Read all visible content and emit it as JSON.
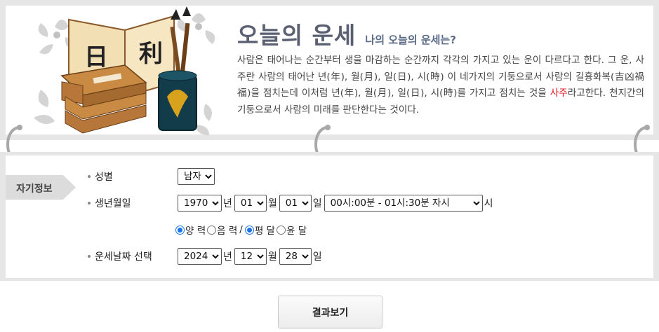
{
  "header": {
    "title": "오늘의 운세",
    "subtitle": "나의 오늘의 운세는?",
    "desc_part1": "사람은 태어나는 순간부터 생을 마감하는 순간까지 각각의 가지고 있는 운이 다르다고 한다. 그 운, 사주란 사람의 태어난 년(年), 월(月), 일(日), 시(時) 이 네가지의 기둥으로서 사람의 길흉화복(吉凶禍福)을 점치는데 이처럼 년(年), 월(月), 일(日), 시(時)를 가지고 점치는 것을 ",
    "desc_highlight": "사주",
    "desc_part2": "라고한다. 천지간의 기둥으로서 사람의 미래를 판단한다는 것이다.",
    "book_chars": [
      "日",
      "利"
    ]
  },
  "form": {
    "tag_label": "자기정보",
    "gender": {
      "label": "성별",
      "selected": "남자"
    },
    "birth": {
      "label": "생년월일",
      "year": "1970",
      "year_unit": "년",
      "month": "01",
      "month_unit": "월",
      "day": "01",
      "day_unit": "일",
      "time": "00시:00분 - 01시:30분 자시",
      "time_unit": "시"
    },
    "calendar": {
      "solar": "양 력",
      "lunar": "음 력",
      "sep": "/",
      "normal": "평 달",
      "leap": "윤 달",
      "solar_checked": true,
      "normal_checked": true
    },
    "fortune_date": {
      "label": "운세날짜 선택",
      "year": "2024",
      "year_unit": "년",
      "month": "12",
      "month_unit": "월",
      "day": "28",
      "day_unit": "일"
    }
  },
  "result_button": "결과보기",
  "colors": {
    "title": "#5a6072",
    "highlight": "#e0191f",
    "radio": "#1a73e8"
  }
}
